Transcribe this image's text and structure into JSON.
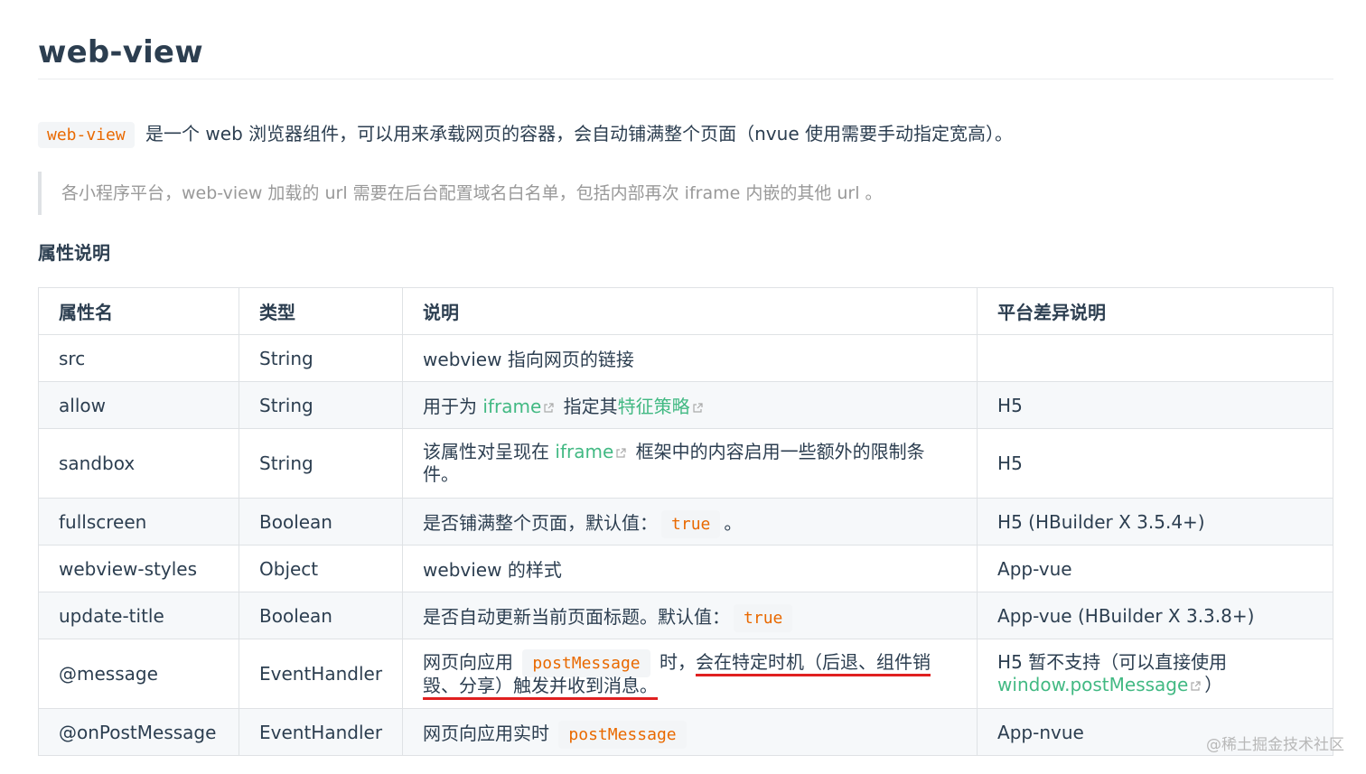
{
  "title": "web-view",
  "intro": {
    "code": "web-view",
    "text": " 是一个 web 浏览器组件，可以用来承载网页的容器，会自动铺满整个页面（nvue 使用需要手动指定宽高）。"
  },
  "quote": "各小程序平台，web-view 加载的 url 需要在后台配置域名白名单，包括内部再次 iframe 内嵌的其他 url 。",
  "section_title": "属性说明",
  "table": {
    "headers": [
      "属性名",
      "类型",
      "说明",
      "平台差异说明"
    ],
    "rows": [
      {
        "name": "src",
        "type": "String",
        "desc": "webview 指向网页的链接",
        "platform": ""
      },
      {
        "name": "allow",
        "type": "String",
        "desc_a": "用于为 ",
        "desc_link1": "iframe",
        "desc_b": " 指定其",
        "desc_link2": "特征策略",
        "platform": "H5"
      },
      {
        "name": "sandbox",
        "type": "String",
        "desc_a": "该属性对呈现在 ",
        "desc_link1": "iframe",
        "desc_b": " 框架中的内容启用一些额外的限制条件。",
        "platform": "H5"
      },
      {
        "name": "fullscreen",
        "type": "Boolean",
        "desc_a": "是否铺满整个页面，默认值：",
        "desc_code": "true",
        "desc_b": "。",
        "platform": "H5 (HBuilder X 3.5.4+)"
      },
      {
        "name": "webview-styles",
        "type": "Object",
        "desc": "webview 的样式",
        "platform": "App-vue"
      },
      {
        "name": "update-title",
        "type": "Boolean",
        "desc_a": "是否自动更新当前页面标题。默认值：",
        "desc_code": "true",
        "platform": "App-vue (HBuilder X 3.3.8+)"
      },
      {
        "name": "@message",
        "type": "EventHandler",
        "desc_a": "网页向应用 ",
        "desc_code": "postMessage",
        "desc_b": " 时，",
        "desc_underlined": "会在特定时机（后退、组件销毁、分享）触发并收到消息。",
        "platform_a": "H5 暂不支持（可以直接使用 ",
        "platform_link": "window.postMessage",
        "platform_b": "）"
      },
      {
        "name": "@onPostMessage",
        "type": "EventHandler",
        "desc_a": "网页向应用实时 ",
        "desc_code": "postMessage",
        "platform": "App-nvue"
      }
    ]
  },
  "watermark": "@稀土掘金技术社区",
  "colors": {
    "text": "#2c3e50",
    "link": "#42b983",
    "code": "#e96900",
    "code_bg": "#f3f5f7",
    "underline": "#e02020"
  }
}
